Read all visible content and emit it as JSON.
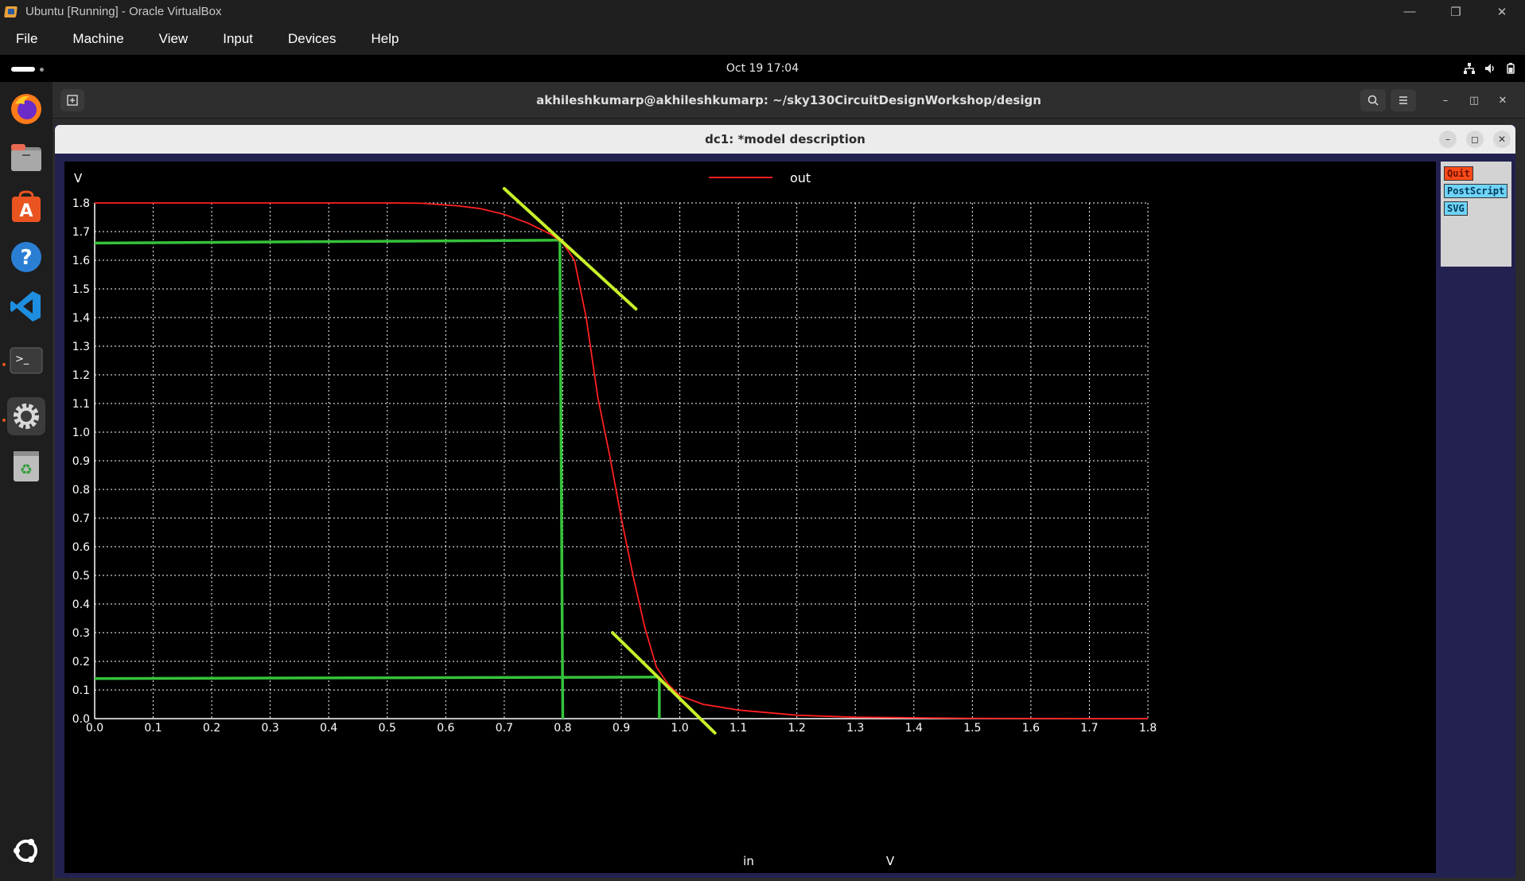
{
  "host": {
    "title": "Ubuntu [Running] - Oracle VirtualBox",
    "menu": [
      "File",
      "Machine",
      "View",
      "Input",
      "Devices",
      "Help"
    ]
  },
  "topbar": {
    "clock": "Oct 19  17:04"
  },
  "dock": {
    "items": [
      "firefox-icon",
      "files-icon",
      "app-center-icon",
      "help-icon",
      "vscode-icon",
      "terminal-icon",
      "settings-icon",
      "trash-icon",
      "ubuntu-logo-icon"
    ]
  },
  "terminal": {
    "title": "akhileshkumarp@akhileshkumarp: ~/sky130CircuitDesignWorkshop/design"
  },
  "plot_window": {
    "title": "dc1: *model description",
    "buttons": {
      "quit": "Quit",
      "postscript": "PostScript",
      "svg": "SVG"
    }
  },
  "colors": {
    "curve": "#ff2020",
    "grid": "#ffffff",
    "marker_green": "#35c23a",
    "tangent_yellow": "#c8f02a",
    "plot_bg": "#000000",
    "window_bg": "#23214f"
  },
  "chart_data": {
    "type": "line",
    "ylabel_unit": "V",
    "xlabel": "in",
    "xlabel_unit": "V",
    "xlim": [
      0,
      1.8
    ],
    "ylim": [
      0,
      1.8
    ],
    "x_ticks": [
      "0.0",
      "0.1",
      "0.2",
      "0.3",
      "0.4",
      "0.5",
      "0.6",
      "0.7",
      "0.8",
      "0.9",
      "1.0",
      "1.1",
      "1.2",
      "1.3",
      "1.4",
      "1.5",
      "1.6",
      "1.7",
      "1.8"
    ],
    "y_ticks": [
      "0.0",
      "0.1",
      "0.2",
      "0.3",
      "0.4",
      "0.5",
      "0.6",
      "0.7",
      "0.8",
      "0.9",
      "1.0",
      "1.1",
      "1.2",
      "1.3",
      "1.4",
      "1.5",
      "1.6",
      "1.7",
      "1.8"
    ],
    "grid": true,
    "legend": "top-center",
    "series": [
      {
        "name": "out",
        "x": [
          0.0,
          0.5,
          0.56,
          0.62,
          0.66,
          0.7,
          0.74,
          0.78,
          0.8,
          0.82,
          0.84,
          0.86,
          0.88,
          0.9,
          0.92,
          0.94,
          0.96,
          0.98,
          1.0,
          1.04,
          1.1,
          1.2,
          1.3,
          1.5,
          1.8
        ],
        "y": [
          1.8,
          1.8,
          1.799,
          1.79,
          1.78,
          1.76,
          1.73,
          1.69,
          1.66,
          1.6,
          1.4,
          1.12,
          0.92,
          0.7,
          0.5,
          0.32,
          0.18,
          0.12,
          0.08,
          0.05,
          0.03,
          0.012,
          0.005,
          0.001,
          0.0
        ]
      }
    ],
    "annotations": {
      "tangent_lines": [
        {
          "x": [
            0.7,
            0.925
          ],
          "y": [
            1.85,
            1.43
          ]
        },
        {
          "x": [
            0.885,
            1.06
          ],
          "y": [
            0.3,
            -0.05
          ]
        }
      ],
      "marker_lines": [
        {
          "x": [
            0.0,
            0.795
          ],
          "y": [
            1.66,
            1.67
          ]
        },
        {
          "x": [
            0.795,
            0.8
          ],
          "y": [
            1.67,
            0.0
          ]
        },
        {
          "x": [
            0.0,
            0.96
          ],
          "y": [
            0.14,
            0.145
          ]
        },
        {
          "x": [
            0.965,
            0.965
          ],
          "y": [
            0.14,
            0.0
          ]
        }
      ]
    }
  }
}
